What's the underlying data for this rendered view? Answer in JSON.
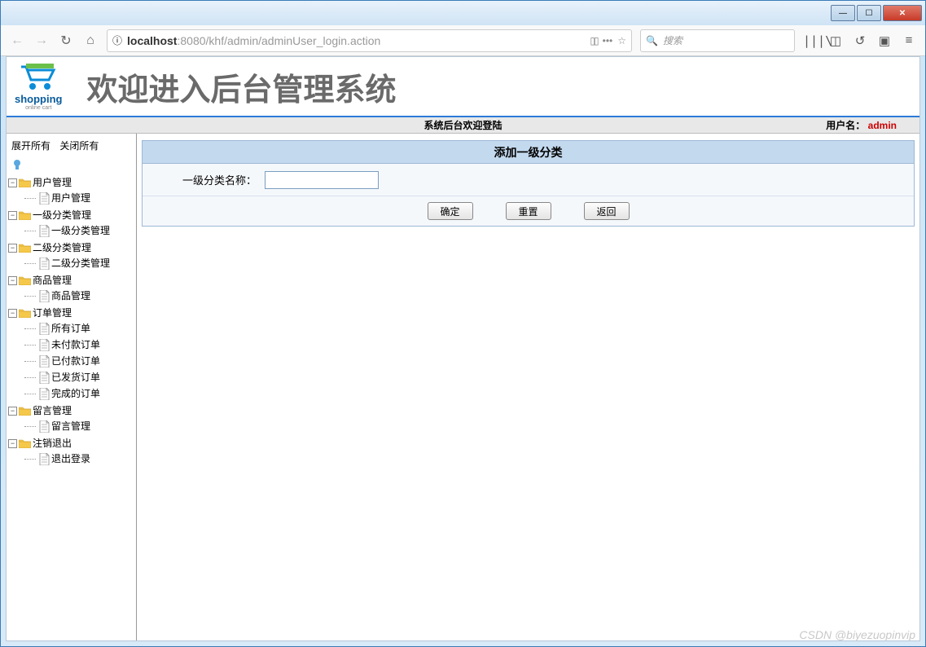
{
  "window": {
    "tab_title": "localhost:8080/khf/admin/admin",
    "url_host": "localhost",
    "url_rest": ":8080/khf/admin/adminUser_login.action",
    "search_placeholder": "搜索"
  },
  "banner": {
    "logo_text": "shopping",
    "logo_sub": "online cart",
    "title": "欢迎进入后台管理系统"
  },
  "statusbar": {
    "center": "系统后台欢迎登陆",
    "user_label": "用户名：",
    "user_name": "admin"
  },
  "sidebar": {
    "expand_all": "展开所有",
    "collapse_all": "关闭所有",
    "tree": [
      {
        "label": "用户管理",
        "children": [
          "用户管理"
        ]
      },
      {
        "label": "一级分类管理",
        "children": [
          "一级分类管理"
        ]
      },
      {
        "label": "二级分类管理",
        "children": [
          "二级分类管理"
        ]
      },
      {
        "label": "商品管理",
        "children": [
          "商品管理"
        ]
      },
      {
        "label": "订单管理",
        "children": [
          "所有订单",
          "未付款订单",
          "已付款订单",
          "已发货订单",
          "完成的订单"
        ]
      },
      {
        "label": "留言管理",
        "children": [
          "留言管理"
        ]
      },
      {
        "label": "注销退出",
        "children": [
          "退出登录"
        ]
      }
    ]
  },
  "form": {
    "title": "添加一级分类",
    "label": "一级分类名称：",
    "value": "",
    "btn_ok": "确定",
    "btn_reset": "重置",
    "btn_back": "返回"
  },
  "watermark": "CSDN @biyezuopinvip"
}
